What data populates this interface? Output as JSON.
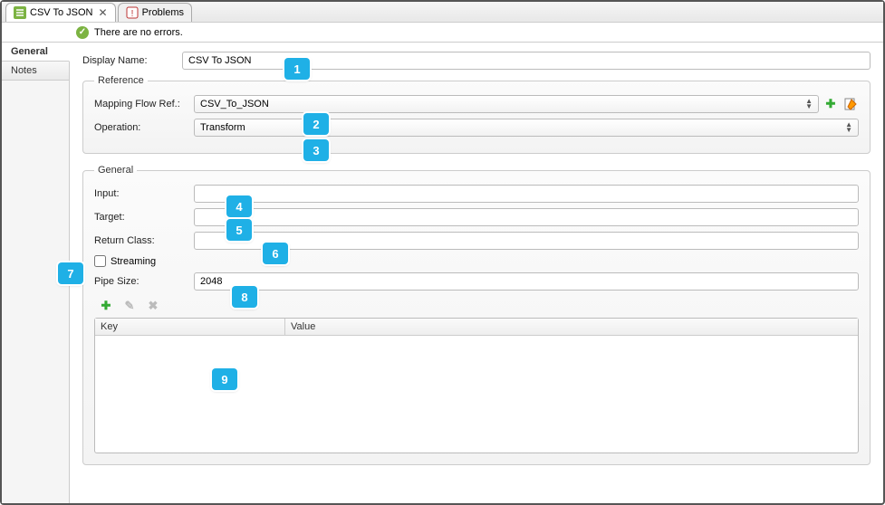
{
  "tabs": {
    "active": {
      "label": "CSV To JSON"
    },
    "inactive": {
      "label": "Problems"
    }
  },
  "status": {
    "message": "There are no errors."
  },
  "sideTabs": {
    "general": "General",
    "notes": "Notes"
  },
  "form": {
    "displayNameLabel": "Display Name:",
    "displayNameValue": "CSV To JSON"
  },
  "reference": {
    "legend": "Reference",
    "mappingLabel": "Mapping Flow Ref.:",
    "mappingValue": "CSV_To_JSON",
    "operationLabel": "Operation:",
    "operationValue": "Transform"
  },
  "general": {
    "legend": "General",
    "inputLabel": "Input:",
    "inputValue": "",
    "targetLabel": "Target:",
    "targetValue": "",
    "returnClassLabel": "Return Class:",
    "returnClassValue": "",
    "streamingLabel": "Streaming",
    "pipeSizeLabel": "Pipe Size:",
    "pipeSizeValue": "2048",
    "keyHeader": "Key",
    "valueHeader": "Value"
  },
  "callouts": [
    "1",
    "2",
    "3",
    "4",
    "5",
    "6",
    "7",
    "8",
    "9"
  ]
}
